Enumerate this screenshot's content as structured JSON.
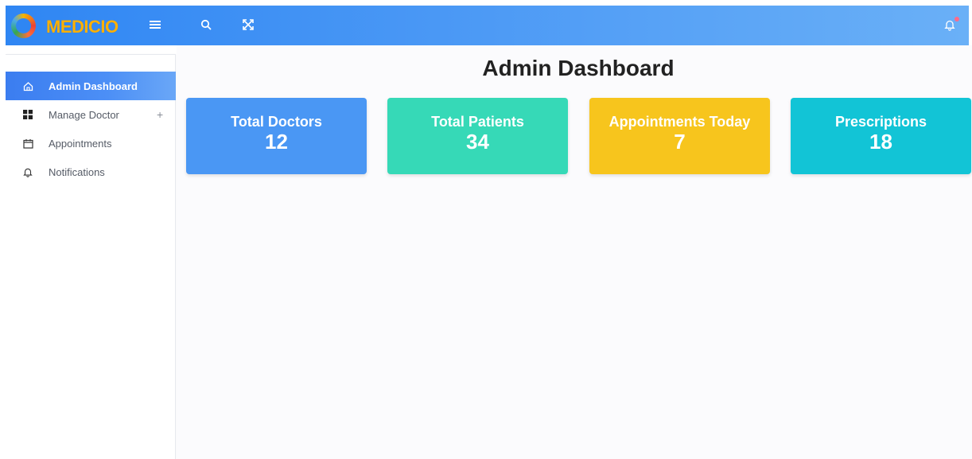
{
  "brand": {
    "name": "MEDICIO",
    "colors": {
      "topbar": "#2f86f3",
      "logo_text": "#ffb000",
      "notification_dot": "#ff6b8a"
    }
  },
  "topbar": {
    "icons": [
      "menu-icon",
      "search-icon",
      "fullscreen-icon",
      "bell-icon"
    ]
  },
  "sidebar": {
    "items": [
      {
        "label": "Admin Dashboard",
        "icon": "home-icon",
        "active": true
      },
      {
        "label": "Manage Doctor",
        "icon": "grid-icon",
        "expand": "+"
      },
      {
        "label": "Appointments",
        "icon": "calendar-icon"
      },
      {
        "label": "Notifications",
        "icon": "bell-icon"
      }
    ]
  },
  "main": {
    "title": "Admin Dashboard",
    "cards": [
      {
        "title": "Total Doctors",
        "value": "12",
        "color": "#4a97f4"
      },
      {
        "title": "Total Patients",
        "value": "34",
        "color": "#36d9b7"
      },
      {
        "title": "Appointments Today",
        "value": "7",
        "color": "#f7c51d"
      },
      {
        "title": "Prescriptions",
        "value": "18",
        "color": "#12c4d6"
      }
    ]
  }
}
